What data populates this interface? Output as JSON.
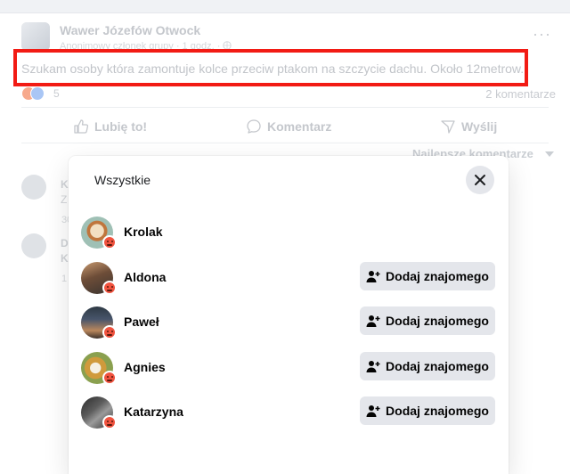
{
  "post": {
    "group_name": "Wawer Józefów Otwock",
    "author_line": "Anonimowy członek grupy · 1 godz. · ",
    "text": "Szukam osoby która zamontuje kolce przeciw ptakom na szczycie dachu. Około 12metrow.",
    "reaction_count": "5",
    "comments_count": "2 komentarze",
    "actions": {
      "like": "Lubię to!",
      "comment": "Komentarz",
      "share": "Wyślij"
    },
    "sort_label": "Najlepsze komentarze",
    "more_label": "···"
  },
  "comments": [
    {
      "initial": "K",
      "line2": "Z",
      "meta": "30"
    },
    {
      "initial": "D",
      "line2": "K",
      "meta": "1"
    }
  ],
  "modal": {
    "tab_label": "Wszystkie",
    "add_friend_label": "Dodaj znajomego",
    "people": [
      {
        "name": "Krolak",
        "reaction": "angry",
        "has_button": false
      },
      {
        "name": "Aldona",
        "reaction": "angry",
        "has_button": true
      },
      {
        "name": "Paweł",
        "reaction": "angry",
        "has_button": true
      },
      {
        "name": "Agnies",
        "reaction": "angry",
        "has_button": true
      },
      {
        "name": "Katarzyna",
        "reaction": "angry",
        "has_button": true
      }
    ]
  },
  "colors": {
    "highlight_border": "#f21b14",
    "angry_reaction": "#f0533f",
    "button_bg": "#e4e6eb"
  }
}
